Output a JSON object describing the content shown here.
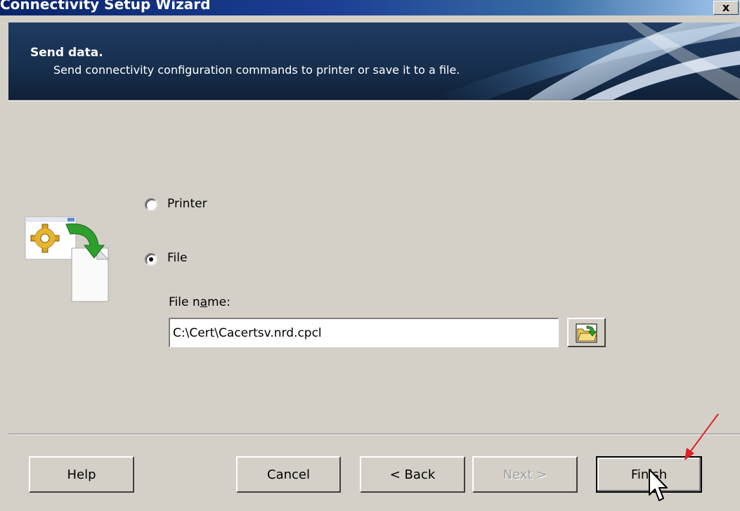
{
  "window": {
    "title": "Connectivity Setup Wizard",
    "close_label": "x"
  },
  "header": {
    "title": "Send data.",
    "subtitle": "Send connectivity configuration commands to printer or save it to a file."
  },
  "options": {
    "printer_label": "Printer",
    "file_label": "File",
    "selected": "File"
  },
  "file": {
    "label_pre": "File n",
    "label_underlined": "a",
    "label_post": "me:",
    "value": "C:\\Cert\\Cacertsv.nrd.cpcl"
  },
  "buttons": {
    "help": "Help",
    "cancel": "Cancel",
    "back": "< Back",
    "next": "Next >",
    "finish": "Finish"
  },
  "icons": {
    "close": "close-icon",
    "wizard": "send-to-file-icon",
    "browse": "folder-open-icon",
    "annotation": "red-arrow-annotation",
    "cursor": "mouse-pointer-icon"
  }
}
